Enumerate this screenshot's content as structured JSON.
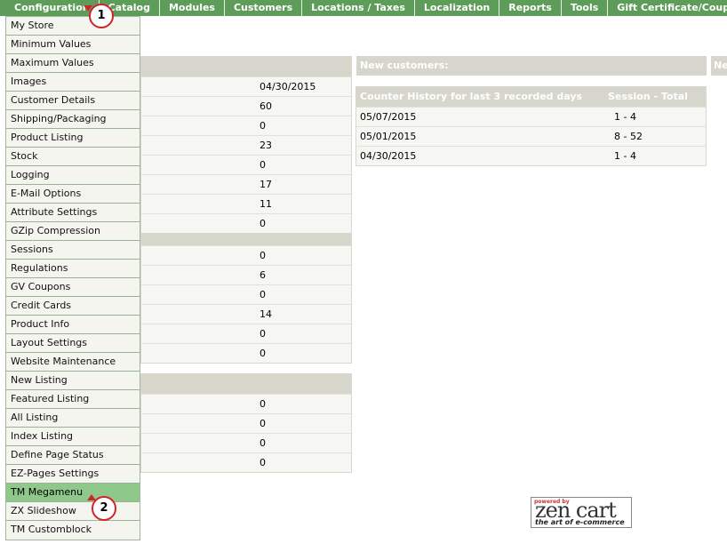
{
  "nav": {
    "items": [
      "Configuration",
      "Catalog",
      "Modules",
      "Customers",
      "Locations / Taxes",
      "Localization",
      "Reports",
      "Tools",
      "Gift Certificate/Coupons"
    ]
  },
  "config_menu": {
    "items": [
      "My Store",
      "Minimum Values",
      "Maximum Values",
      "Images",
      "Customer Details",
      "Shipping/Packaging",
      "Product Listing",
      "Stock",
      "Logging",
      "E-Mail Options",
      "Attribute Settings",
      "GZip Compression",
      "Sessions",
      "Regulations",
      "GV Coupons",
      "Credit Cards",
      "Product Info",
      "Layout Settings",
      "Website Maintenance",
      "New Listing",
      "Featured Listing",
      "All Listing",
      "Index Listing",
      "Define Page Status",
      "EZ-Pages Settings",
      "TM Megamenu",
      "ZX Slideshow",
      "TM Customblock"
    ],
    "active_item": "TM Megamenu"
  },
  "stats": {
    "group1": [
      "04/30/2015",
      "60",
      "0",
      "23",
      "0",
      "17",
      "11",
      "0"
    ],
    "group2": [
      "0",
      "6",
      "0",
      "14",
      "0",
      "0"
    ],
    "group3": [
      "0",
      "0",
      "0",
      "0"
    ]
  },
  "new_customers": {
    "title": "New customers:"
  },
  "right_panel": {
    "title": "Ne"
  },
  "counter": {
    "header_date": "Counter History for last 3 recorded days",
    "header_total": "Session - Total",
    "rows": [
      {
        "date": "05/07/2015",
        "total": "1 - 4"
      },
      {
        "date": "05/01/2015",
        "total": "8 - 52"
      },
      {
        "date": "04/30/2015",
        "total": "1 - 4"
      }
    ]
  },
  "callouts": [
    "1",
    "2"
  ],
  "logo": {
    "powered": "powered by",
    "brand": "zen cart",
    "tagline": "the art of e-commerce"
  },
  "colors": {
    "nav_bg": "#5d9c59",
    "menu_active": "#8fc88b",
    "panel_head": "#d7d6cc",
    "callout": "#d0232a"
  }
}
